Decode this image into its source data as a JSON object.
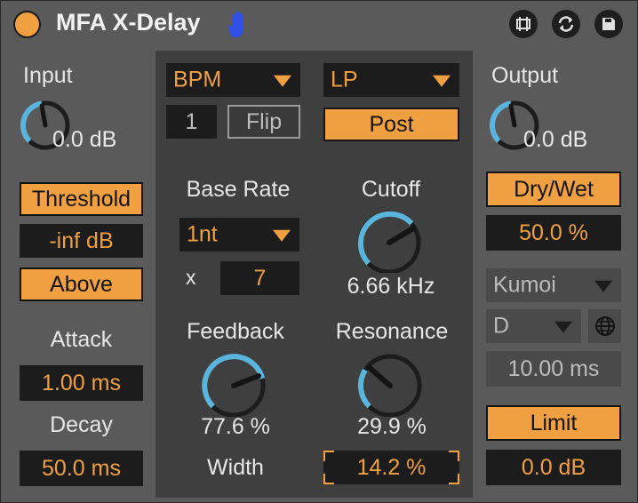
{
  "device": {
    "title": "MFA X-Delay"
  },
  "left": {
    "input_label": "Input",
    "input_value": "0.0 dB",
    "threshold_label": "Threshold",
    "threshold_value": "-inf dB",
    "above_label": "Above",
    "attack_label": "Attack",
    "attack_value": "1.00 ms",
    "decay_label": "Decay",
    "decay_value": "50.0 ms"
  },
  "center": {
    "sync_mode": "BPM",
    "number_value": "1",
    "flip_label": "Flip",
    "filter_type": "LP",
    "post_label": "Post",
    "base_rate_label": "Base Rate",
    "base_rate_value": "1nt",
    "multiplier_symbol": "x",
    "multiplier_value": "7",
    "cutoff_label": "Cutoff",
    "cutoff_value": "6.66 kHz",
    "feedback_label": "Feedback",
    "feedback_value": "77.6 %",
    "resonance_label": "Resonance",
    "resonance_value": "29.9 %",
    "width_label": "Width",
    "width_value": "14.2 %"
  },
  "right": {
    "output_label": "Output",
    "output_value": "0.0 dB",
    "drywet_label": "Dry/Wet",
    "drywet_value": "50.0 %",
    "scale_value": "Kumoi",
    "key_value": "D",
    "time_value": "10.00 ms",
    "limit_label": "Limit",
    "limit_value": "0.0 dB"
  },
  "colors": {
    "accent": "#f0a040",
    "knob_ring": "#5ab4dc",
    "hand_icon": "#3050e8",
    "background": "#5a5a5a",
    "panel": "#3f3f3f"
  },
  "icons": [
    "power-icon",
    "hand-icon",
    "fold-icon",
    "swap-icon",
    "save-icon",
    "globe-icon"
  ]
}
